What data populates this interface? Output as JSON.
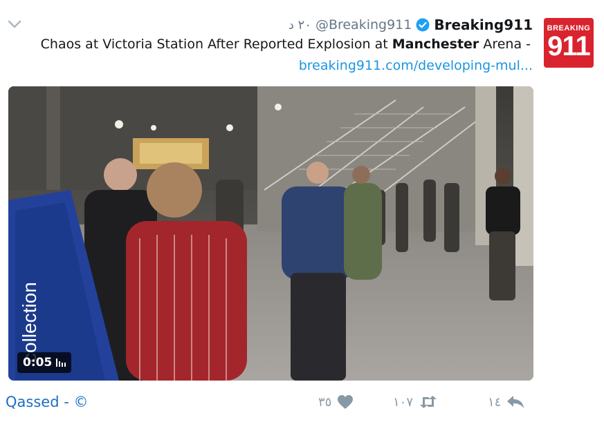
{
  "tweet": {
    "time_ago": "٢٠ د",
    "handle": "@Breaking911",
    "display_name": "Breaking911",
    "text_before": "Chaos at Victoria Station After Reported Explosion at ",
    "text_bold": "Manchester",
    "text_after": " Arena -",
    "link": "breaking911.com/developing-mul...",
    "avatar_top": "BREAKING",
    "avatar_big": "911",
    "video_duration": "0:05",
    "video_sign_text": "collection",
    "replies": "١٤",
    "retweets": "١٠٧",
    "likes": "٣٥"
  },
  "footer": {
    "credit": "Qassed - ©"
  },
  "colors": {
    "link": "#1b95e0",
    "verified": "#1da1f2",
    "action_gray": "#8899a6",
    "avatar_red": "#d9232e",
    "credit_blue": "#1b6fc4"
  },
  "icons": {
    "menu": "chevron-down-icon",
    "verified": "verified-badge-icon",
    "reply": "reply-icon",
    "retweet": "retweet-icon",
    "like": "heart-icon",
    "volume": "volume-bars-icon"
  }
}
